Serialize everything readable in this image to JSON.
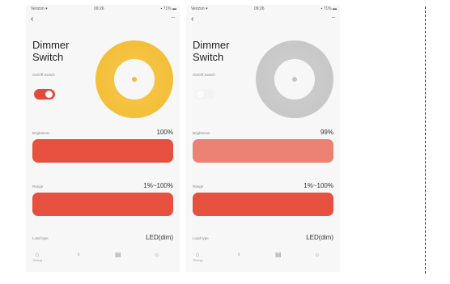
{
  "screens": [
    {
      "status": {
        "carrier": "Verizon ▾",
        "time": "09:26",
        "battery": "▪ 71% ▬"
      },
      "back_icon": "‹",
      "more_icon": "···",
      "title_line1": "Dimmer",
      "title_line2": "Switch",
      "switch_label": "On/Off Switch",
      "switch_state": "on",
      "dial_color": "#f3bf3a",
      "brightness_label": "Brightness",
      "brightness_value": "100%",
      "brightness_level": 1.0,
      "range_label": "Range",
      "range_value": "1%~100%",
      "load_type_label": "Load type",
      "load_type_value": "LED(dim)",
      "tabs": [
        {
          "icon": "house-icon",
          "label": "Timing"
        },
        {
          "icon": "lightbulb-icon",
          "label": ""
        },
        {
          "icon": "calendar-icon",
          "label": ""
        },
        {
          "icon": "settings-icon",
          "label": ""
        }
      ]
    },
    {
      "status": {
        "carrier": "Verizon ▾",
        "time": "09:26",
        "battery": "▪ 71% ▬"
      },
      "back_icon": "‹",
      "more_icon": "···",
      "title_line1": "Dimmer",
      "title_line2": "Switch",
      "switch_label": "On/Off Switch",
      "switch_state": "off",
      "dial_color": "#c4c4c4",
      "brightness_label": "Brightness",
      "brightness_value": "99%",
      "brightness_level": 0.99,
      "range_label": "Range",
      "range_value": "1%~100%",
      "load_type_label": "Load type",
      "load_type_value": "LED(dim)",
      "tabs": [
        {
          "icon": "house-icon",
          "label": "Timing"
        },
        {
          "icon": "lightbulb-icon",
          "label": ""
        },
        {
          "icon": "calendar-icon",
          "label": ""
        },
        {
          "icon": "settings-icon",
          "label": ""
        }
      ]
    }
  ],
  "colors": {
    "accent": "#e5503f",
    "accent_faded": "#ea8173",
    "dial_on": "#f3bf3a",
    "dial_off": "#c4c4c4"
  }
}
